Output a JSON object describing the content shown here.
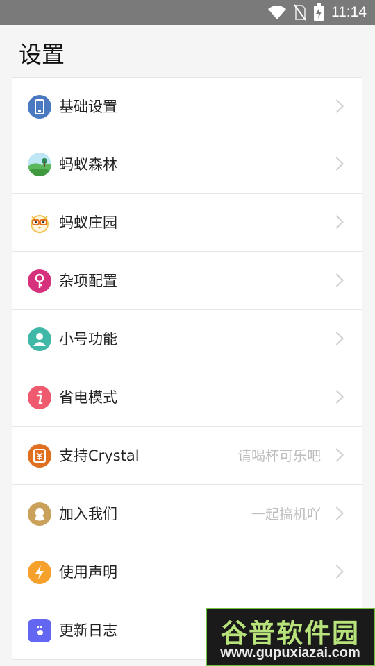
{
  "status_bar": {
    "time": "11:14"
  },
  "page": {
    "title": "设置"
  },
  "items": [
    {
      "label": "基础设置",
      "hint": "",
      "icon": "phone-icon",
      "color": "#4a79c2"
    },
    {
      "label": "蚂蚁森林",
      "hint": "",
      "icon": "forest-icon",
      "color": "#5cb85c"
    },
    {
      "label": "蚂蚁庄园",
      "hint": "",
      "icon": "chicken-icon",
      "color": "#f2c14e"
    },
    {
      "label": "杂项配置",
      "hint": "",
      "icon": "key-icon",
      "color": "#d6317d"
    },
    {
      "label": "小号功能",
      "hint": "",
      "icon": "person-icon",
      "color": "#3fb8a8"
    },
    {
      "label": "省电模式",
      "hint": "",
      "icon": "info-icon",
      "color": "#f05a6e"
    },
    {
      "label": "支持Crystal",
      "hint": "请喝杯可乐吧",
      "icon": "yen-coupon-icon",
      "color": "#e0701f"
    },
    {
      "label": "加入我们",
      "hint": "一起搞机吖",
      "icon": "qq-penguin-icon",
      "color": "#c9a15a"
    },
    {
      "label": "使用声明",
      "hint": "",
      "icon": "lightning-icon",
      "color": "#f6a12b"
    },
    {
      "label": "更新日志",
      "hint": "",
      "icon": "log-icon",
      "color": "#6366f1"
    }
  ],
  "watermark": {
    "title": "谷普软件园",
    "url": "www.gupuxiazai.com"
  }
}
